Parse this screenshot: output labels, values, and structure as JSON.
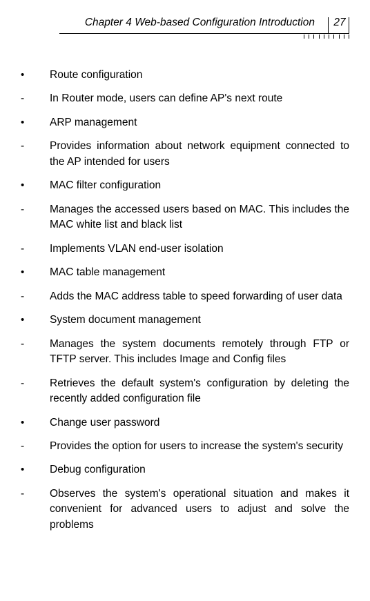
{
  "header": {
    "chapter_title": "Chapter 4 Web-based Configuration Introduction",
    "page_number": "27"
  },
  "items": [
    {
      "marker": "bullet",
      "justify": false,
      "text": "Route configuration"
    },
    {
      "marker": "dash",
      "justify": false,
      "text": "In Router mode, users can define AP's next route"
    },
    {
      "marker": "bullet",
      "justify": false,
      "text": "ARP management"
    },
    {
      "marker": "dash",
      "justify": true,
      "text": "Provides information about network equipment connected to the AP intended for users"
    },
    {
      "marker": "bullet",
      "justify": false,
      "text": "MAC filter configuration"
    },
    {
      "marker": "dash",
      "justify": true,
      "text": "Manages the accessed users based on MAC. This includes the MAC white list and black list"
    },
    {
      "marker": "dash",
      "justify": false,
      "text": "Implements VLAN end-user isolation"
    },
    {
      "marker": "bullet",
      "justify": false,
      "text": "MAC table management"
    },
    {
      "marker": "dash",
      "justify": true,
      "text": "Adds the MAC address table to speed forwarding of user data"
    },
    {
      "marker": "bullet",
      "justify": false,
      "text": "System document management"
    },
    {
      "marker": "dash",
      "justify": true,
      "text": "Manages the system documents remotely through FTP or TFTP server. This includes Image and Config files"
    },
    {
      "marker": "dash",
      "justify": true,
      "text": "Retrieves the default system's configuration by deleting the recently added configuration file"
    },
    {
      "marker": "bullet",
      "justify": false,
      "text": "Change user password"
    },
    {
      "marker": "dash",
      "justify": true,
      "text": "Provides the option for users to increase the system's security"
    },
    {
      "marker": "bullet",
      "justify": false,
      "text": "Debug configuration"
    },
    {
      "marker": "dash",
      "justify": true,
      "text": "Observes the system's operational situation and makes it convenient for advanced users to adjust and solve the problems"
    }
  ]
}
